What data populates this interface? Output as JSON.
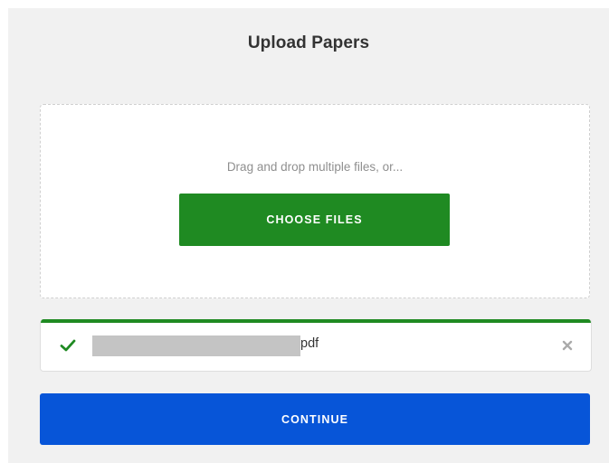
{
  "page": {
    "title": "Upload Papers"
  },
  "dropzone": {
    "hint": "Drag and drop multiple files, or...",
    "choose_label": "CHOOSE FILES"
  },
  "files": [
    {
      "name_visible": "pdf",
      "name_redacted": true,
      "status": "uploaded",
      "progress": 1.0,
      "status_icon": "check-icon",
      "remove_icon": "close-icon"
    }
  ],
  "actions": {
    "continue_label": "CONTINUE"
  },
  "colors": {
    "panel_bg": "#f1f1f1",
    "success_green": "#1f8a22",
    "primary_blue": "#0755d8",
    "redaction_gray": "#c4c4c4"
  }
}
